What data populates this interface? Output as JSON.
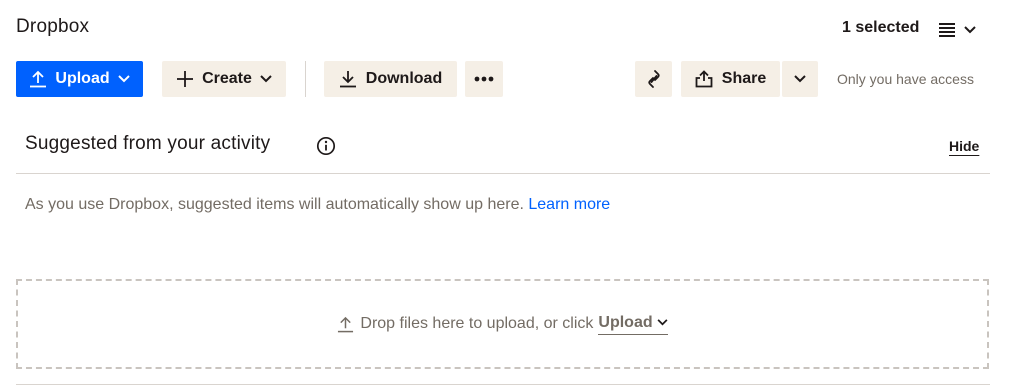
{
  "header": {
    "title": "Dropbox",
    "selection_status": "1 selected"
  },
  "toolbar": {
    "upload_label": "Upload",
    "create_label": "Create",
    "download_label": "Download",
    "share_label": "Share",
    "access_text": "Only you have access"
  },
  "suggested": {
    "title": "Suggested from your activity",
    "hide_label": "Hide",
    "description": "As you use Dropbox, suggested items will automatically show up here.",
    "learn_more": "Learn more"
  },
  "dropzone": {
    "text": "Drop files here to upload, or click",
    "upload_link": "Upload"
  },
  "icons": {
    "upload": "upload-arrow-icon",
    "plus": "plus-icon",
    "download": "download-arrow-icon",
    "more": "more-horizontal-icon",
    "link": "link-icon",
    "share": "share-icon",
    "chevron": "chevron-down-icon",
    "list_view": "list-view-icon",
    "info": "info-icon"
  },
  "colors": {
    "primary": "#0061fe",
    "button_beige": "#f5efe6",
    "text_primary": "#1e1919",
    "text_secondary": "#736c64",
    "divider": "#d9d4cf"
  }
}
